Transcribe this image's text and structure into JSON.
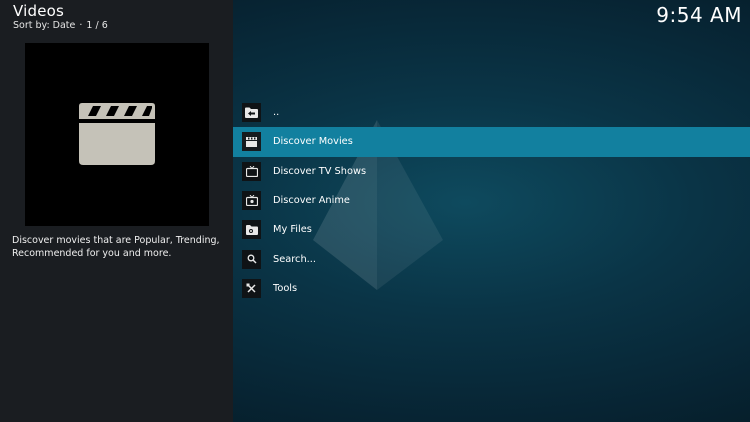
{
  "header": {
    "title": "Videos",
    "sort_label": "Sort by: Date",
    "separator": "·",
    "page": "1 / 6"
  },
  "clock": "9:54 AM",
  "info": {
    "thumbnail_icon": "clapperboard-icon",
    "description": "Discover movies that are Popular, Trending, Recommended for you and more."
  },
  "menu": {
    "selected_index": 1,
    "items": [
      {
        "label": "..",
        "icon": "folder-back-icon"
      },
      {
        "label": "Discover Movies",
        "icon": "movies-icon"
      },
      {
        "label": "Discover TV Shows",
        "icon": "tv-icon"
      },
      {
        "label": "Discover Anime",
        "icon": "anime-tv-icon"
      },
      {
        "label": "My Files",
        "icon": "files-icon"
      },
      {
        "label": "Search...",
        "icon": "search-icon"
      },
      {
        "label": "Tools",
        "icon": "tools-icon"
      }
    ]
  },
  "colors": {
    "accent": "#12809f",
    "left_panel": "#1a1d21",
    "background": "#0a3446"
  }
}
